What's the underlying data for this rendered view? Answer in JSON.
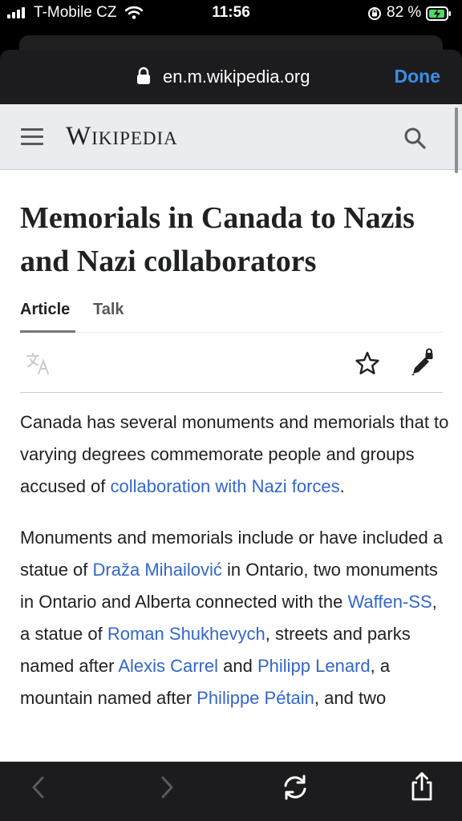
{
  "status_bar": {
    "carrier": "T-Mobile CZ",
    "time": "11:56",
    "battery_percent": "82 %",
    "icons": [
      "signal-icon",
      "wifi-icon",
      "orientation-lock-icon",
      "battery-charging-icon"
    ]
  },
  "browser": {
    "url": "en.m.wikipedia.org",
    "done_label": "Done"
  },
  "wiki": {
    "wordmark": "Wikipedia",
    "title": "Memorials in Canada to Nazis and Nazi collaborators",
    "tabs": [
      {
        "label": "Article",
        "active": true
      },
      {
        "label": "Talk",
        "active": false
      }
    ],
    "paragraph1": [
      {
        "text": "Canada has several monuments and memorials that to varying degrees commemorate people and groups accused of "
      },
      {
        "text": "collaboration with Nazi forces",
        "link": true
      },
      {
        "text": "."
      }
    ],
    "paragraph2": [
      {
        "text": "Monuments and memorials include or have included a statue of "
      },
      {
        "text": "Draža Mihailović",
        "link": true
      },
      {
        "text": " in Ontario, two monuments in Ontario and Alberta connected with the "
      },
      {
        "text": "Waffen-SS",
        "link": true
      },
      {
        "text": ", a statue of "
      },
      {
        "text": "Roman Shukhevych",
        "link": true
      },
      {
        "text": ", streets and parks named after "
      },
      {
        "text": "Alexis Carrel",
        "link": true
      },
      {
        "text": " and "
      },
      {
        "text": "Philipp Lenard",
        "link": true
      },
      {
        "text": ", a mountain named after "
      },
      {
        "text": "Philippe Pétain",
        "link": true
      },
      {
        "text": ", and two"
      }
    ]
  },
  "colors": {
    "link": "#3366cc",
    "done": "#3a8fe6",
    "header_bg": "#eaecf0",
    "toolbar_bg": "#1c1c1e"
  }
}
